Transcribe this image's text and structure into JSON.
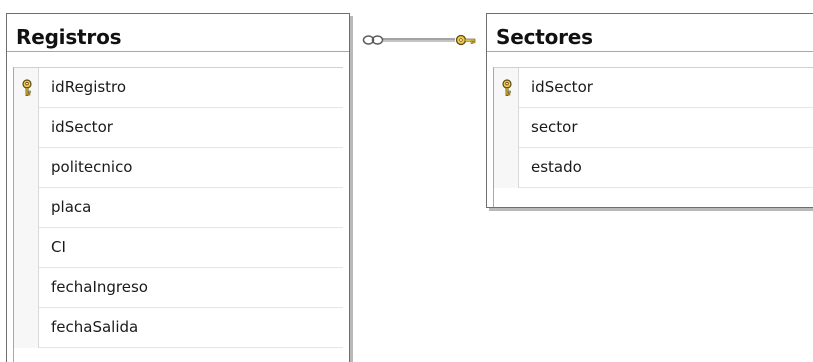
{
  "tables": [
    {
      "name": "Registros",
      "columns": [
        {
          "name": "idRegistro",
          "primary_key": true
        },
        {
          "name": "idSector",
          "primary_key": false
        },
        {
          "name": "politecnico",
          "primary_key": false
        },
        {
          "name": "placa",
          "primary_key": false
        },
        {
          "name": "CI",
          "primary_key": false
        },
        {
          "name": "fechaIngreso",
          "primary_key": false
        },
        {
          "name": "fechaSalida",
          "primary_key": false
        }
      ]
    },
    {
      "name": "Sectores",
      "columns": [
        {
          "name": "idSector",
          "primary_key": true
        },
        {
          "name": "sector",
          "primary_key": false
        },
        {
          "name": "estado",
          "primary_key": false
        }
      ]
    }
  ],
  "relationship": {
    "from_table": "Registros",
    "to_table": "Sectores",
    "from_end": "many-infinity-icon",
    "to_end": "one-key-icon"
  },
  "colors": {
    "key_fill": "#f2c94c",
    "key_stroke": "#5a4a12",
    "box_border": "#6f6f6f",
    "shadow": "#b9b9b9",
    "connector": "#5a5a5a"
  }
}
